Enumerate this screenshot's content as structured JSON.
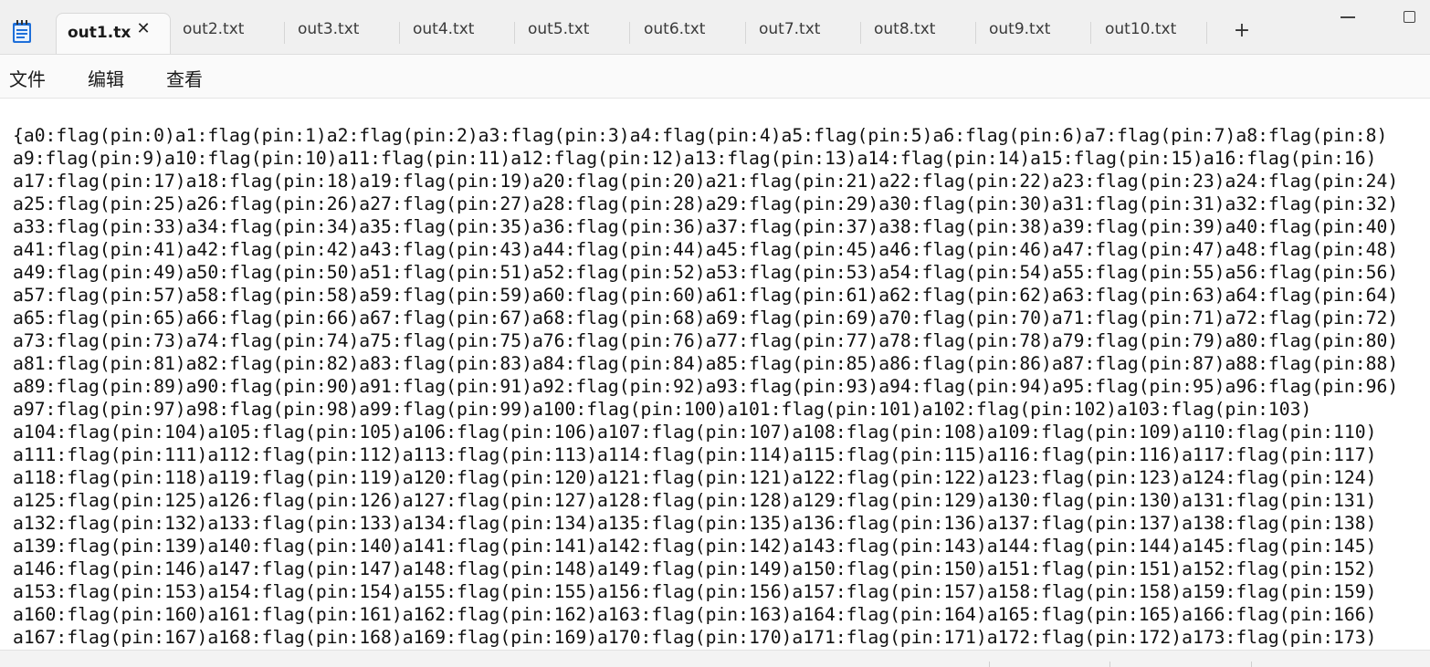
{
  "window": {
    "icon": "notepad-icon",
    "minimize_icon": "minimize-icon",
    "maximize_icon": "maximize-icon"
  },
  "tabs": [
    {
      "label": "out1.tx",
      "active": true
    },
    {
      "label": "out2.txt"
    },
    {
      "label": "out3.txt"
    },
    {
      "label": "out4.txt"
    },
    {
      "label": "out5.txt"
    },
    {
      "label": "out6.txt"
    },
    {
      "label": "out7.txt"
    },
    {
      "label": "out8.txt"
    },
    {
      "label": "out9.txt"
    },
    {
      "label": "out10.txt"
    }
  ],
  "tab_close_symbol": "✕",
  "new_tab_symbol": "+",
  "menu": {
    "file": "文件",
    "edit": "编辑",
    "view": "查看"
  },
  "editor": {
    "lines": [
      "{a0:flag(pin:0)a1:flag(pin:1)a2:flag(pin:2)a3:flag(pin:3)a4:flag(pin:4)a5:flag(pin:5)a6:flag(pin:6)a7:flag(pin:7)a8:flag(pin:8)",
      "a9:flag(pin:9)a10:flag(pin:10)a11:flag(pin:11)a12:flag(pin:12)a13:flag(pin:13)a14:flag(pin:14)a15:flag(pin:15)a16:flag(pin:16)",
      "a17:flag(pin:17)a18:flag(pin:18)a19:flag(pin:19)a20:flag(pin:20)a21:flag(pin:21)a22:flag(pin:22)a23:flag(pin:23)a24:flag(pin:24)",
      "a25:flag(pin:25)a26:flag(pin:26)a27:flag(pin:27)a28:flag(pin:28)a29:flag(pin:29)a30:flag(pin:30)a31:flag(pin:31)a32:flag(pin:32)",
      "a33:flag(pin:33)a34:flag(pin:34)a35:flag(pin:35)a36:flag(pin:36)a37:flag(pin:37)a38:flag(pin:38)a39:flag(pin:39)a40:flag(pin:40)",
      "a41:flag(pin:41)a42:flag(pin:42)a43:flag(pin:43)a44:flag(pin:44)a45:flag(pin:45)a46:flag(pin:46)a47:flag(pin:47)a48:flag(pin:48)",
      "a49:flag(pin:49)a50:flag(pin:50)a51:flag(pin:51)a52:flag(pin:52)a53:flag(pin:53)a54:flag(pin:54)a55:flag(pin:55)a56:flag(pin:56)",
      "a57:flag(pin:57)a58:flag(pin:58)a59:flag(pin:59)a60:flag(pin:60)a61:flag(pin:61)a62:flag(pin:62)a63:flag(pin:63)a64:flag(pin:64)",
      "a65:flag(pin:65)a66:flag(pin:66)a67:flag(pin:67)a68:flag(pin:68)a69:flag(pin:69)a70:flag(pin:70)a71:flag(pin:71)a72:flag(pin:72)",
      "a73:flag(pin:73)a74:flag(pin:74)a75:flag(pin:75)a76:flag(pin:76)a77:flag(pin:77)a78:flag(pin:78)a79:flag(pin:79)a80:flag(pin:80)",
      "a81:flag(pin:81)a82:flag(pin:82)a83:flag(pin:83)a84:flag(pin:84)a85:flag(pin:85)a86:flag(pin:86)a87:flag(pin:87)a88:flag(pin:88)",
      "a89:flag(pin:89)a90:flag(pin:90)a91:flag(pin:91)a92:flag(pin:92)a93:flag(pin:93)a94:flag(pin:94)a95:flag(pin:95)a96:flag(pin:96)",
      "a97:flag(pin:97)a98:flag(pin:98)a99:flag(pin:99)a100:flag(pin:100)a101:flag(pin:101)a102:flag(pin:102)a103:flag(pin:103)",
      "a104:flag(pin:104)a105:flag(pin:105)a106:flag(pin:106)a107:flag(pin:107)a108:flag(pin:108)a109:flag(pin:109)a110:flag(pin:110)",
      "a111:flag(pin:111)a112:flag(pin:112)a113:flag(pin:113)a114:flag(pin:114)a115:flag(pin:115)a116:flag(pin:116)a117:flag(pin:117)",
      "a118:flag(pin:118)a119:flag(pin:119)a120:flag(pin:120)a121:flag(pin:121)a122:flag(pin:122)a123:flag(pin:123)a124:flag(pin:124)",
      "a125:flag(pin:125)a126:flag(pin:126)a127:flag(pin:127)a128:flag(pin:128)a129:flag(pin:129)a130:flag(pin:130)a131:flag(pin:131)",
      "a132:flag(pin:132)a133:flag(pin:133)a134:flag(pin:134)a135:flag(pin:135)a136:flag(pin:136)a137:flag(pin:137)a138:flag(pin:138)",
      "a139:flag(pin:139)a140:flag(pin:140)a141:flag(pin:141)a142:flag(pin:142)a143:flag(pin:143)a144:flag(pin:144)a145:flag(pin:145)",
      "a146:flag(pin:146)a147:flag(pin:147)a148:flag(pin:148)a149:flag(pin:149)a150:flag(pin:150)a151:flag(pin:151)a152:flag(pin:152)",
      "a153:flag(pin:153)a154:flag(pin:154)a155:flag(pin:155)a156:flag(pin:156)a157:flag(pin:157)a158:flag(pin:158)a159:flag(pin:159)",
      "a160:flag(pin:160)a161:flag(pin:161)a162:flag(pin:162)a163:flag(pin:163)a164:flag(pin:164)a165:flag(pin:165)a166:flag(pin:166)",
      "a167:flag(pin:167)a168:flag(pin:168)a169:flag(pin:169)a170:flag(pin:170)a171:flag(pin:171)a172:flag(pin:172)a173:flag(pin:173)"
    ]
  },
  "colors": {
    "titlebar": "#f0f0f0",
    "editor_bg": "#ffffff",
    "text": "#111111",
    "icon_blue": "#1e6fd9"
  }
}
